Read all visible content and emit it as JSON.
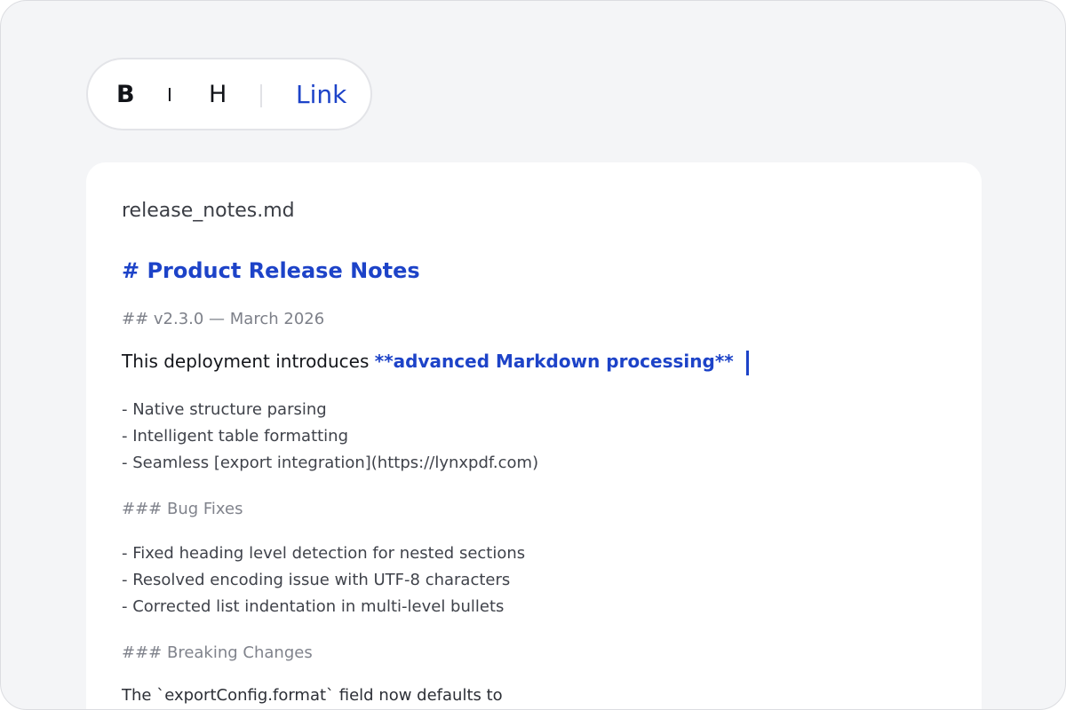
{
  "toolbar": {
    "bold_label": "B",
    "italic_label": "I",
    "heading_label": "H",
    "link_label": "Link"
  },
  "document": {
    "filename": "release_notes.md",
    "heading1": "# Product Release Notes",
    "heading2": "## v2.3.0 — March 2026",
    "intro_text": "This deployment introduces ",
    "intro_strong": "**advanced Markdown processing**",
    "features": [
      "- Native structure parsing",
      "- Intelligent table formatting",
      "- Seamless [export integration](https://lynxpdf.com)"
    ],
    "bug_fixes_heading": "### Bug Fixes",
    "bug_fixes": [
      "- Fixed heading level detection for nested sections",
      "- Resolved encoding issue with UTF-8 characters",
      "- Corrected list indentation in multi-level bullets"
    ],
    "breaking_heading": "### Breaking Changes",
    "breaking_text": "The `exportConfig.format` field now defaults to"
  },
  "colors": {
    "accent": "#1d43c8",
    "background": "#f4f5f7",
    "panel": "#ffffff"
  }
}
